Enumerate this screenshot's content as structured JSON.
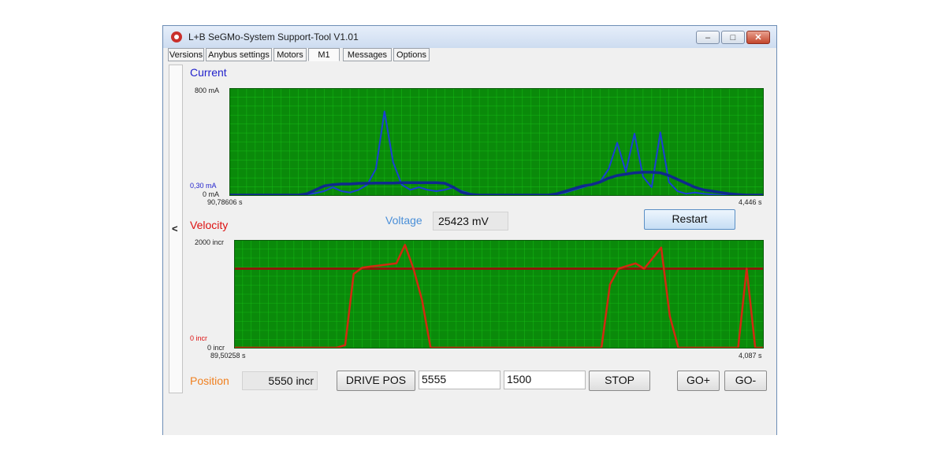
{
  "window": {
    "title": "L+B SeGMo-System Support-Tool V1.01",
    "buttons": {
      "minimize": "–",
      "maximize": "□",
      "close": "✕"
    }
  },
  "tabs": [
    "Versions",
    "Anybus settings",
    "Motors",
    "M1",
    "Messages",
    "Options"
  ],
  "active_tab": "M1",
  "collapse_label": "<",
  "current_chart": {
    "label": "Current",
    "y_max_label": "800 mA",
    "y_marker_label": "0,30 mA",
    "y_min_label": "0 mA",
    "x_left_label": "90,78606 s",
    "x_right_label": "4,446 s",
    "bg_color": "#0a8a0a",
    "grid_color": "#0cd40c"
  },
  "voltage": {
    "label": "Voltage",
    "value": "25423 mV"
  },
  "restart_label": "Restart",
  "velocity_chart": {
    "label": "Velocity",
    "y_max_label": "2000 incr",
    "y_marker_label": "0 incr",
    "y_min_label": "0 incr",
    "x_left_label": "89,50258 s",
    "x_right_label": "4,087 s",
    "bg_color": "#0a8a0a"
  },
  "position": {
    "label": "Position",
    "value": "5550 incr"
  },
  "drive_pos_label": "DRIVE POS",
  "drive_pos_value": "5555",
  "speed_value": "1500",
  "stop_label": "STOP",
  "go_plus_label": "GO+",
  "go_minus_label": "GO-",
  "chart_data": [
    {
      "type": "line",
      "title": "Current",
      "ylim": [
        0,
        800
      ],
      "series": [
        {
          "color": "#1a3fd6",
          "values": [
            0,
            0,
            0,
            0,
            0,
            0,
            0,
            0,
            0,
            5,
            15,
            30,
            60,
            30,
            20,
            40,
            80,
            200,
            640,
            250,
            80,
            40,
            60,
            40,
            30,
            40,
            60,
            30,
            10,
            0,
            0,
            0,
            0,
            0,
            0,
            0,
            0,
            0,
            5,
            20,
            40,
            60,
            80,
            100,
            200,
            400,
            180,
            470,
            140,
            60,
            480,
            100,
            30,
            10,
            20,
            10,
            5,
            0,
            0,
            0,
            0,
            0,
            0
          ]
        },
        {
          "color": "#0f2a8c",
          "values": [
            0,
            0,
            0,
            0,
            0,
            0,
            0,
            0,
            0,
            10,
            40,
            70,
            80,
            85,
            85,
            90,
            90,
            92,
            92,
            92,
            95,
            95,
            95,
            95,
            95,
            90,
            60,
            20,
            5,
            0,
            0,
            0,
            0,
            0,
            0,
            0,
            0,
            0,
            10,
            30,
            50,
            70,
            80,
            100,
            130,
            150,
            160,
            170,
            175,
            175,
            170,
            150,
            120,
            90,
            60,
            40,
            30,
            20,
            10,
            5,
            0,
            0,
            0
          ]
        }
      ]
    },
    {
      "type": "line",
      "title": "Velocity",
      "ylim": [
        0,
        2000
      ],
      "series": [
        {
          "color": "#8b1a0a",
          "values": [
            1500,
            1500,
            1500,
            1500,
            1500,
            1500,
            1500,
            1500,
            1500,
            1500,
            1500,
            1500,
            1500,
            1500,
            1500,
            1500,
            1500,
            1500,
            1500,
            1500,
            1500,
            1500,
            1500,
            1500,
            1500,
            1500,
            1500,
            1500,
            1500,
            1500,
            1500,
            1500,
            1500,
            1500,
            1500,
            1500,
            1500,
            1500,
            1500,
            1500,
            1500,
            1500,
            1500,
            1500,
            1500,
            1500,
            1500,
            1500,
            1500,
            1500,
            1500,
            1500,
            1500,
            1500,
            1500,
            1500,
            1500,
            1500,
            1500,
            1500,
            1500,
            1500,
            1500
          ]
        },
        {
          "color": "#d22a10",
          "values": [
            0,
            0,
            0,
            0,
            0,
            0,
            0,
            0,
            0,
            0,
            0,
            0,
            0,
            50,
            1400,
            1520,
            1540,
            1560,
            1580,
            1600,
            1950,
            1500,
            900,
            0,
            0,
            0,
            0,
            0,
            0,
            0,
            0,
            0,
            0,
            0,
            0,
            0,
            0,
            0,
            0,
            0,
            0,
            0,
            0,
            0,
            1200,
            1500,
            1550,
            1600,
            1500,
            1700,
            1900,
            600,
            0,
            0,
            0,
            0,
            0,
            0,
            0,
            0,
            1500,
            0,
            0
          ]
        }
      ]
    }
  ]
}
